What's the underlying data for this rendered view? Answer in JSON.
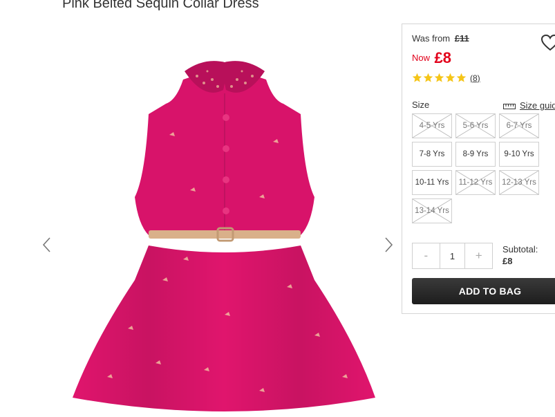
{
  "product": {
    "title": "Pink Belted Sequin Collar Dress",
    "image_alt": "pink-sequin-collar-dress-image"
  },
  "pricing": {
    "was_label": "Was from",
    "was_price": "£11",
    "now_label": "Now",
    "now_price": "£8"
  },
  "rating": {
    "stars": 5,
    "max_stars": 5,
    "count_text": "(8)",
    "star_color": "#f5c518"
  },
  "size": {
    "label": "Size",
    "guide_label": "Size guide",
    "options": [
      {
        "label": "4-5 Yrs",
        "available": false
      },
      {
        "label": "5-6 Yrs",
        "available": false
      },
      {
        "label": "6-7 Yrs",
        "available": false
      },
      {
        "label": "7-8 Yrs",
        "available": true
      },
      {
        "label": "8-9 Yrs",
        "available": true
      },
      {
        "label": "9-10 Yrs",
        "available": true
      },
      {
        "label": "10-11 Yrs",
        "available": true
      },
      {
        "label": "11-12 Yrs",
        "available": false
      },
      {
        "label": "12-13 Yrs",
        "available": false
      },
      {
        "label": "13-14 Yrs",
        "available": false
      }
    ]
  },
  "quantity": {
    "minus_label": "-",
    "value": "1",
    "plus_label": "+"
  },
  "subtotal": {
    "label": "Subtotal:",
    "value": "£8"
  },
  "cta": {
    "add_to_bag": "ADD TO BAG"
  },
  "colors": {
    "sale_red": "#e2001a",
    "dress_pink": "#e0156d",
    "button_dark": "#262626"
  }
}
